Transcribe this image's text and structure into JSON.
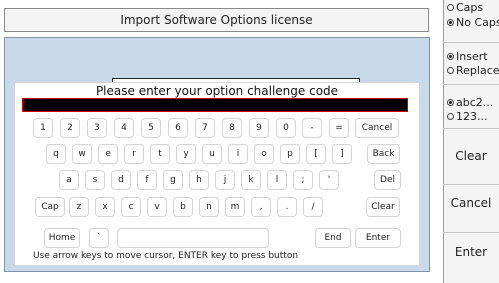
{
  "header": {
    "title": "Import Software Options license"
  },
  "dialog": {
    "prompt": "Please enter your option challenge code",
    "hint": "Use arrow keys to move cursor, ENTER key to press button"
  },
  "keyboard": {
    "row1": [
      "1",
      "2",
      "3",
      "4",
      "5",
      "6",
      "7",
      "8",
      "9",
      "0",
      "-",
      "=",
      "Cancel"
    ],
    "row2": [
      "q",
      "w",
      "e",
      "r",
      "t",
      "y",
      "u",
      "i",
      "o",
      "p",
      "[",
      "]",
      "Back"
    ],
    "row3": [
      "a",
      "s",
      "d",
      "f",
      "g",
      "h",
      "j",
      "k",
      "l",
      ";",
      "'",
      "Del"
    ],
    "row4": [
      "Cap",
      "z",
      "x",
      "c",
      "v",
      "b",
      "n",
      "m",
      ",",
      ".",
      "/",
      "Clear"
    ],
    "row5": [
      "Home",
      "`",
      "End",
      "Enter"
    ]
  },
  "sidebar": {
    "case_options": [
      {
        "label": "Caps",
        "selected": false
      },
      {
        "label": "No Caps",
        "selected": true
      }
    ],
    "mode_options": [
      {
        "label": "Insert",
        "selected": true
      },
      {
        "label": "Replace",
        "selected": false
      }
    ],
    "charset_options": [
      {
        "label": "abc2...",
        "selected": true
      },
      {
        "label": "123...",
        "selected": false
      }
    ],
    "buttons": [
      "Clear",
      "Cancel",
      "Enter"
    ]
  },
  "colors": {
    "code_field": "#000000",
    "code_field_border": "#d00000",
    "panel": "#c8d9ea"
  }
}
